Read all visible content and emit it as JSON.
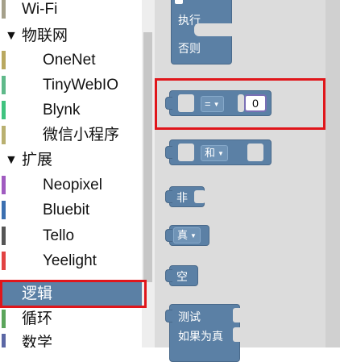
{
  "sidebar": {
    "items": [
      {
        "label": "Wi-Fi",
        "kind": "top",
        "color": "#a5a08a"
      },
      {
        "label": "物联网",
        "kind": "group",
        "arrow": "▼"
      },
      {
        "label": "OneNet",
        "kind": "child",
        "color": "#b9a860"
      },
      {
        "label": "TinyWebIO",
        "kind": "child",
        "color": "#5fb98a"
      },
      {
        "label": "Blynk",
        "kind": "child",
        "color": "#3fc37f"
      },
      {
        "label": "微信小程序",
        "kind": "child",
        "color": "#b9b070"
      },
      {
        "label": "扩展",
        "kind": "group",
        "arrow": "▼"
      },
      {
        "label": "Neopixel",
        "kind": "child",
        "color": "#a05bc0"
      },
      {
        "label": "Bluebit",
        "kind": "child",
        "color": "#3b6fb0"
      },
      {
        "label": "Tello",
        "kind": "child",
        "color": "#555555"
      },
      {
        "label": "Yeelight",
        "kind": "child",
        "color": "#e24242"
      },
      {
        "label": "逻辑",
        "kind": "top",
        "color": "#5b80a5",
        "selected": true
      },
      {
        "label": "循环",
        "kind": "top",
        "color": "#5ba55b"
      },
      {
        "label": "数学",
        "kind": "top",
        "color": "#5b67a5"
      }
    ]
  },
  "blocks": {
    "if_else": {
      "do_label": "执行",
      "else_label": "否则"
    },
    "compare": {
      "operator": "=",
      "value": "0"
    },
    "logic_operation": {
      "operator": "和"
    },
    "negate": {
      "label": "非"
    },
    "boolean": {
      "value": "真"
    },
    "null": {
      "label": "空"
    },
    "ternary": {
      "test_label": "测试",
      "then_label": "如果为真"
    }
  },
  "colors": {
    "logic": "#5b80a5",
    "highlight": "#e0161b",
    "selected_bg": "#5b80a5"
  }
}
